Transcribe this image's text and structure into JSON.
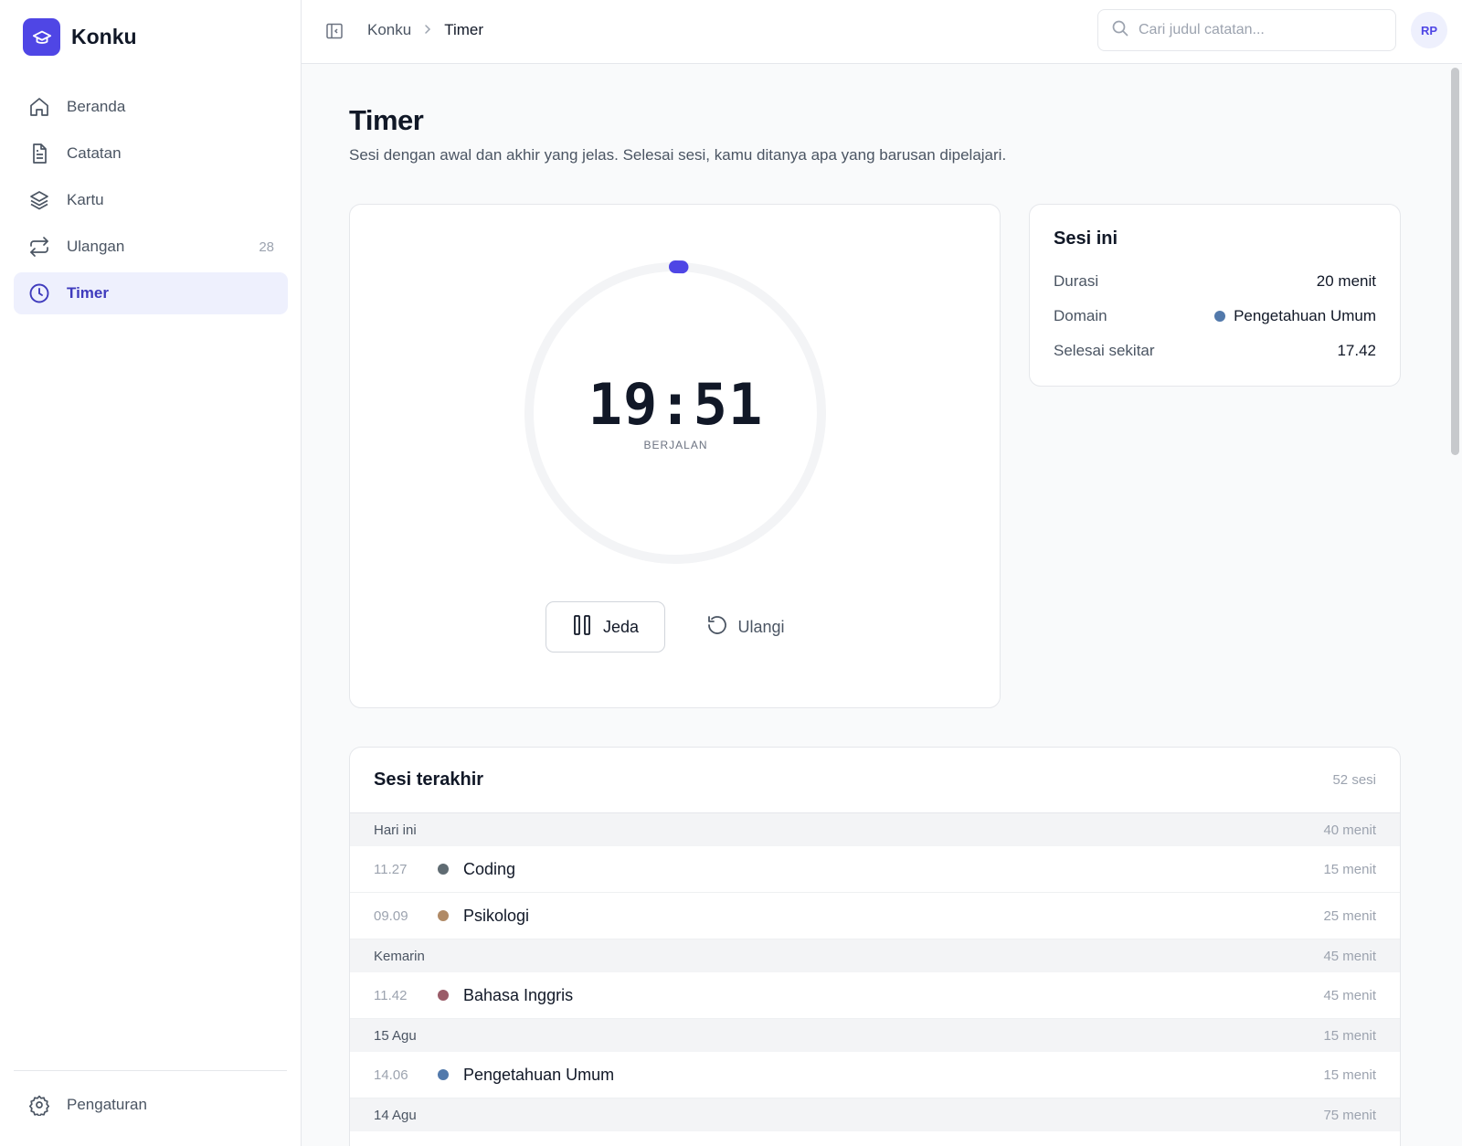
{
  "app": {
    "name": "Konku"
  },
  "sidebar": {
    "items": [
      {
        "label": "Beranda",
        "icon": "home-icon",
        "count": ""
      },
      {
        "label": "Catatan",
        "icon": "document-icon",
        "count": ""
      },
      {
        "label": "Kartu",
        "icon": "layers-icon",
        "count": ""
      },
      {
        "label": "Ulangan",
        "icon": "repeat-icon",
        "count": "28"
      },
      {
        "label": "Timer",
        "icon": "clock-icon",
        "count": "",
        "active": true
      }
    ],
    "settings_label": "Pengaturan"
  },
  "header": {
    "breadcrumb_root": "Konku",
    "breadcrumb_current": "Timer",
    "search_placeholder": "Cari judul catatan...",
    "avatar_initials": "RP"
  },
  "page": {
    "title": "Timer",
    "subtitle": "Sesi dengan awal dan akhir yang jelas. Selesai sesi, kamu ditanya apa yang barusan dipelajari."
  },
  "timer": {
    "time": "19:51",
    "status": "BERJALAN",
    "progress_fraction": 0.0075,
    "pause_label": "Jeda",
    "reset_label": "Ulangi"
  },
  "session": {
    "title": "Sesi ini",
    "duration_label": "Durasi",
    "duration_value": "20 menit",
    "domain_label": "Domain",
    "domain_value": "Pengetahuan Umum",
    "finish_label": "Selesai sekitar",
    "finish_value": "17.42"
  },
  "recent": {
    "title": "Sesi terakhir",
    "count": "52 sesi",
    "groups": [
      {
        "label": "Hari ini",
        "total": "40 menit",
        "items": [
          {
            "time": "11.27",
            "name": "Coding",
            "duration": "15 menit",
            "color": "#5f6b72"
          },
          {
            "time": "09.09",
            "name": "Psikologi",
            "duration": "25 menit",
            "color": "#b08a66"
          }
        ]
      },
      {
        "label": "Kemarin",
        "total": "45 menit",
        "items": [
          {
            "time": "11.42",
            "name": "Bahasa Inggris",
            "duration": "45 menit",
            "color": "#9a5c68"
          }
        ]
      },
      {
        "label": "15 Agu",
        "total": "15 menit",
        "items": [
          {
            "time": "14.06",
            "name": "Pengetahuan Umum",
            "duration": "15 menit",
            "color": "#5279ab"
          }
        ]
      },
      {
        "label": "14 Agu",
        "total": "75 menit",
        "items": []
      }
    ]
  },
  "colors": {
    "accent": "#4f46e5",
    "accent_soft": "#eef0fd",
    "domain_pengetahuan_umum": "#5279ab"
  }
}
